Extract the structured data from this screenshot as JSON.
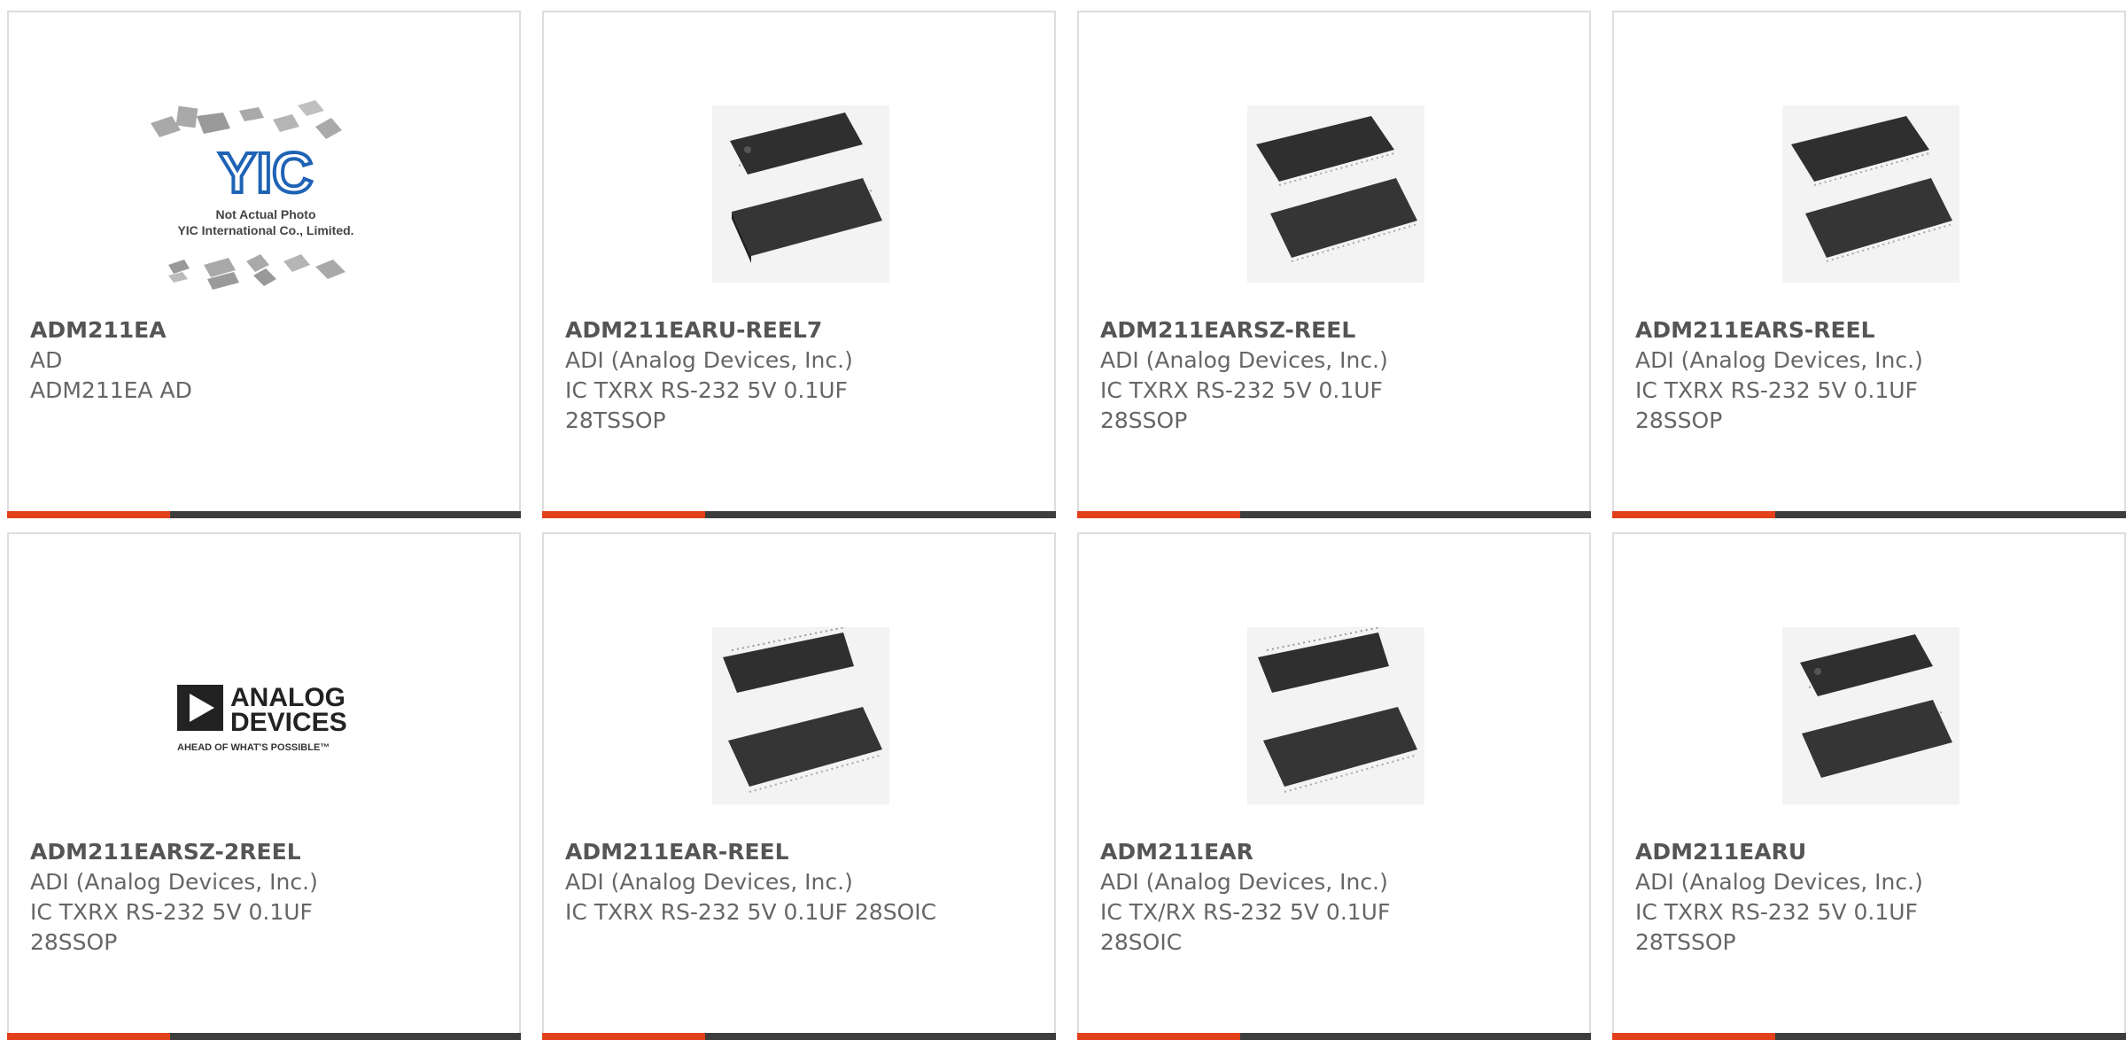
{
  "accent_color": "#e2401a",
  "bar_color": "#3d3d3d",
  "products": [
    {
      "part_number": "ADM211EA",
      "manufacturer": "AD",
      "desc1": "ADM211EA AD",
      "desc2": "",
      "image": "yic-not-actual-photo",
      "image_text": {
        "logo": "YIC",
        "line1": "Not Actual Photo",
        "line2": "YIC International Co., Limited."
      }
    },
    {
      "part_number": "ADM211EARU-REEL7",
      "manufacturer": "ADI (Analog Devices, Inc.)",
      "desc1": "IC TXRX RS-232 5V 0.1UF",
      "desc2": "28TSSOP",
      "image": "ic-chip-photo"
    },
    {
      "part_number": "ADM211EARSZ-REEL",
      "manufacturer": "ADI (Analog Devices, Inc.)",
      "desc1": "IC TXRX RS-232 5V 0.1UF",
      "desc2": "28SSOP",
      "image": "ic-chip-photo"
    },
    {
      "part_number": "ADM211EARS-REEL",
      "manufacturer": "ADI (Analog Devices, Inc.)",
      "desc1": "IC TXRX RS-232 5V 0.1UF",
      "desc2": "28SSOP",
      "image": "ic-chip-photo"
    },
    {
      "part_number": "ADM211EARSZ-2REEL",
      "manufacturer": "ADI (Analog Devices, Inc.)",
      "desc1": "IC TXRX RS-232 5V 0.1UF",
      "desc2": "28SSOP",
      "image": "analog-devices-logo",
      "image_text": {
        "line1": "ANALOG",
        "line2": "DEVICES",
        "tagline": "AHEAD OF WHAT'S POSSIBLE™"
      }
    },
    {
      "part_number": "ADM211EAR-REEL",
      "manufacturer": "ADI (Analog Devices, Inc.)",
      "desc1": "IC TXRX RS-232 5V 0.1UF 28SOIC",
      "desc2": "",
      "image": "ic-chip-photo"
    },
    {
      "part_number": "ADM211EAR",
      "manufacturer": "ADI (Analog Devices, Inc.)",
      "desc1": "IC TX/RX RS-232 5V 0.1UF",
      "desc2": "28SOIC",
      "image": "ic-chip-photo"
    },
    {
      "part_number": "ADM211EARU",
      "manufacturer": "ADI (Analog Devices, Inc.)",
      "desc1": "IC TXRX RS-232 5V 0.1UF",
      "desc2": "28TSSOP",
      "image": "ic-chip-photo"
    }
  ]
}
